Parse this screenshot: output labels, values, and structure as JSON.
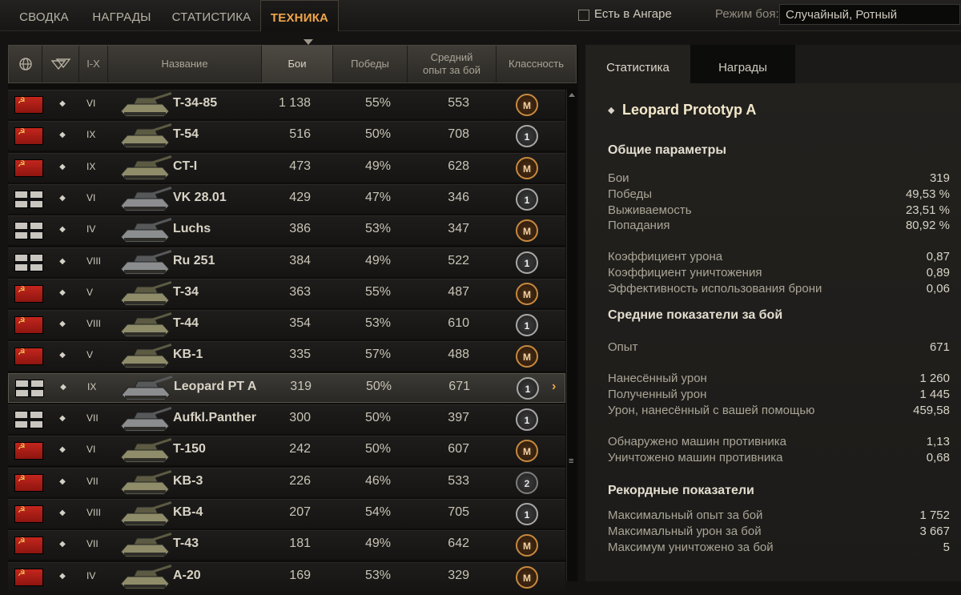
{
  "nav": {
    "tabs": [
      {
        "label": "СВОДКА"
      },
      {
        "label": "НАГРАДЫ"
      },
      {
        "label": "СТАТИСТИКА"
      },
      {
        "label": "ТЕХНИКА"
      }
    ],
    "in_garage_label": "Есть в Ангаре",
    "battle_mode_label": "Режим боя:",
    "battle_mode_value": "Случайный, Ротный"
  },
  "table": {
    "headers": {
      "tier": "I-X",
      "name": "Название",
      "battles": "Бои",
      "wins": "Победы",
      "avg_exp_line1": "Средний",
      "avg_exp_line2": "опыт за бой",
      "mastery": "Классность"
    },
    "rows": [
      {
        "nation": "ussr",
        "tier": "VI",
        "name": "T-34-85",
        "battles": "1 138",
        "wins": "55%",
        "avg_exp": "553",
        "badge": "M",
        "badge_type": "b-m"
      },
      {
        "nation": "ussr",
        "tier": "IX",
        "name": "T-54",
        "battles": "516",
        "wins": "50%",
        "avg_exp": "708",
        "badge": "1",
        "badge_type": "b-1"
      },
      {
        "nation": "ussr",
        "tier": "IX",
        "name": "CT-I",
        "battles": "473",
        "wins": "49%",
        "avg_exp": "628",
        "badge": "M",
        "badge_type": "b-m"
      },
      {
        "nation": "germany",
        "tier": "VI",
        "name": "VK 28.01",
        "battles": "429",
        "wins": "47%",
        "avg_exp": "346",
        "badge": "1",
        "badge_type": "b-1"
      },
      {
        "nation": "germany",
        "tier": "IV",
        "name": "Luchs",
        "battles": "386",
        "wins": "53%",
        "avg_exp": "347",
        "badge": "M",
        "badge_type": "b-m"
      },
      {
        "nation": "germany",
        "tier": "VIII",
        "name": "Ru 251",
        "battles": "384",
        "wins": "49%",
        "avg_exp": "522",
        "badge": "1",
        "badge_type": "b-1"
      },
      {
        "nation": "ussr",
        "tier": "V",
        "name": "T-34",
        "battles": "363",
        "wins": "55%",
        "avg_exp": "487",
        "badge": "M",
        "badge_type": "b-m"
      },
      {
        "nation": "ussr",
        "tier": "VIII",
        "name": "T-44",
        "battles": "354",
        "wins": "53%",
        "avg_exp": "610",
        "badge": "1",
        "badge_type": "b-1"
      },
      {
        "nation": "ussr",
        "tier": "V",
        "name": "KB-1",
        "battles": "335",
        "wins": "57%",
        "avg_exp": "488",
        "badge": "M",
        "badge_type": "b-m"
      },
      {
        "nation": "germany",
        "tier": "IX",
        "name": "Leopard PT A",
        "battles": "319",
        "wins": "50%",
        "avg_exp": "671",
        "badge": "1",
        "badge_type": "b-1",
        "selected": true
      },
      {
        "nation": "germany",
        "tier": "VII",
        "name": "Aufkl.Panther",
        "battles": "300",
        "wins": "50%",
        "avg_exp": "397",
        "badge": "1",
        "badge_type": "b-1"
      },
      {
        "nation": "ussr",
        "tier": "VI",
        "name": "T-150",
        "battles": "242",
        "wins": "50%",
        "avg_exp": "607",
        "badge": "M",
        "badge_type": "b-m"
      },
      {
        "nation": "ussr",
        "tier": "VII",
        "name": "KB-3",
        "battles": "226",
        "wins": "46%",
        "avg_exp": "533",
        "badge": "2",
        "badge_type": "b-2"
      },
      {
        "nation": "ussr",
        "tier": "VIII",
        "name": "KB-4",
        "battles": "207",
        "wins": "54%",
        "avg_exp": "705",
        "badge": "1",
        "badge_type": "b-1"
      },
      {
        "nation": "ussr",
        "tier": "VII",
        "name": "T-43",
        "battles": "181",
        "wins": "49%",
        "avg_exp": "642",
        "badge": "M",
        "badge_type": "b-m"
      },
      {
        "nation": "ussr",
        "tier": "IV",
        "name": "A-20",
        "battles": "169",
        "wins": "53%",
        "avg_exp": "329",
        "badge": "M",
        "badge_type": "b-m"
      }
    ],
    "selected_indicator": "›"
  },
  "details": {
    "tab_stats": "Статистика",
    "tab_awards": "Награды",
    "vehicle_name": "Leopard Prototyp A",
    "sections": [
      {
        "title": "Общие параметры",
        "groups": [
          [
            {
              "label": "Бои",
              "value": "319"
            },
            {
              "label": "Победы",
              "value": "49,53 %"
            },
            {
              "label": "Выживаемость",
              "value": "23,51 %"
            },
            {
              "label": "Попадания",
              "value": "80,92 %"
            }
          ],
          [
            {
              "label": "Коэффициент урона",
              "value": "0,87"
            },
            {
              "label": "Коэффициент уничтожения",
              "value": "0,89"
            },
            {
              "label": "Эффективность использования брони",
              "value": "0,06"
            }
          ]
        ]
      },
      {
        "title": "Средние показатели за бой",
        "groups": [
          [
            {
              "label": "Опыт",
              "value": "671"
            }
          ],
          [
            {
              "label": "Нанесённый урон",
              "value": "1 260"
            },
            {
              "label": "Полученный урон",
              "value": "1 445"
            },
            {
              "label": "Урон, нанесённый с вашей помощью",
              "value": "459,58"
            }
          ],
          [
            {
              "label": "Обнаружено машин противника",
              "value": "1,13"
            },
            {
              "label": "Уничтожено машин противника",
              "value": "0,68"
            }
          ]
        ]
      },
      {
        "title": "Рекордные показатели",
        "groups": [
          [
            {
              "label": "Максимальный опыт за бой",
              "value": "1 752"
            },
            {
              "label": "Максимальный урон за бой",
              "value": "3 667"
            },
            {
              "label": "Максимум уничтожено за бой",
              "value": "5"
            }
          ]
        ]
      }
    ]
  },
  "colors": {
    "accent": "#f0a54a",
    "background": "#141312"
  }
}
